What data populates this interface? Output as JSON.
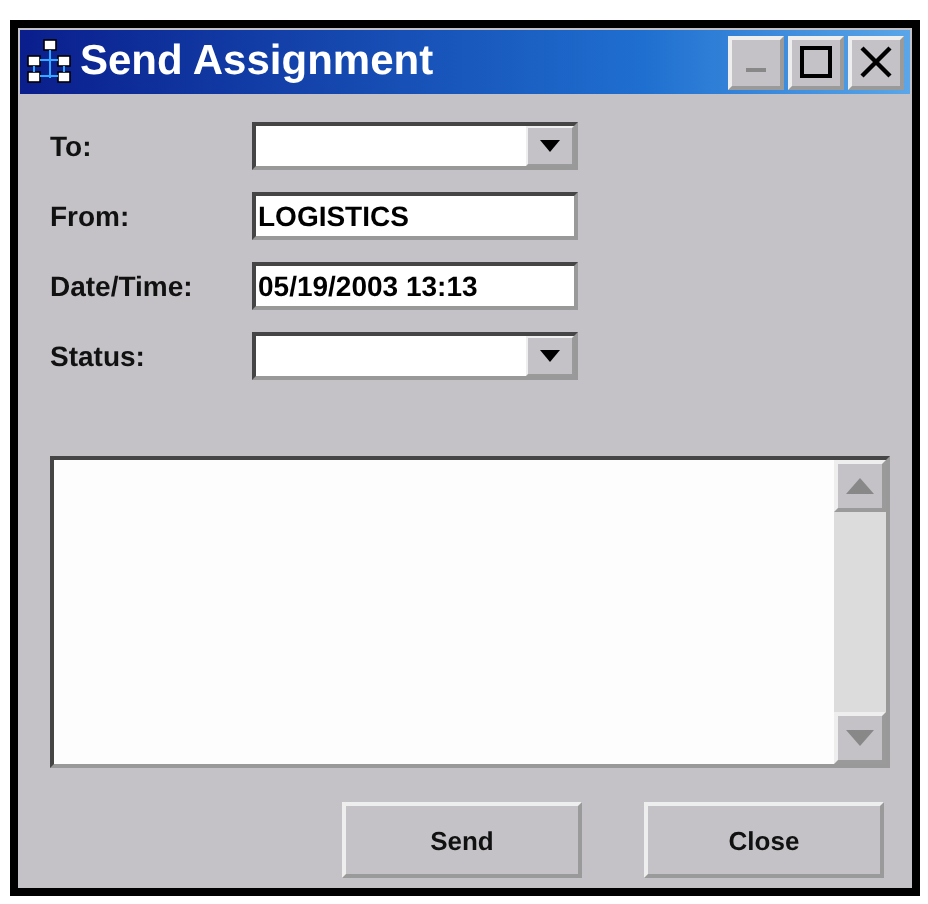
{
  "window": {
    "title": "Send Assignment"
  },
  "fields": [
    {
      "label": "To:",
      "kind": "dropdown"
    },
    {
      "label": "From:",
      "kind": "text",
      "value": "LOGISTICS"
    },
    {
      "label": "Date/Time:",
      "kind": "text",
      "value": "05/19/2003 13:13"
    },
    {
      "label": "Status:",
      "kind": "dropdown"
    }
  ],
  "buttons": [
    "Send",
    "Close"
  ]
}
